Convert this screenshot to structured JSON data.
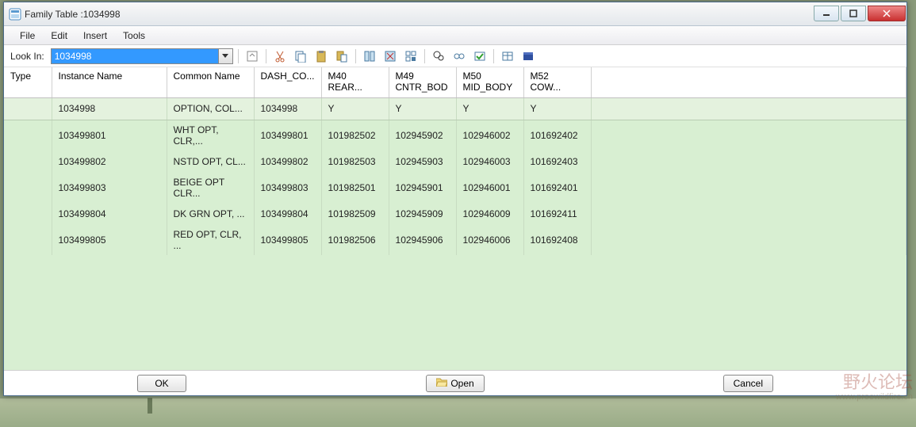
{
  "window": {
    "title": "Family Table :1034998"
  },
  "menu": [
    "File",
    "Edit",
    "Insert",
    "Tools"
  ],
  "lookin": {
    "label": "Look In:",
    "value": "1034998"
  },
  "toolbar_icons": [
    "open-instance-icon",
    "cut-icon",
    "copy-icon",
    "paste-icon",
    "paste-special-icon",
    "add-column-icon",
    "delete-column-icon",
    "find-icon",
    "preview-icon",
    "verify-icon",
    "table-icon",
    "lock-icon"
  ],
  "columns": [
    {
      "key": "type",
      "label": "Type",
      "cls": "col-type"
    },
    {
      "key": "instance",
      "label": "Instance Name",
      "cls": "col-inst"
    },
    {
      "key": "common",
      "label": "Common Name",
      "cls": "col-common"
    },
    {
      "key": "dash",
      "label": "DASH_CO...",
      "cls": "col-dash"
    },
    {
      "key": "m40",
      "label": "M40\nREAR...",
      "cls": "col-m"
    },
    {
      "key": "m49",
      "label": "M49\nCNTR_BOD",
      "cls": "col-m"
    },
    {
      "key": "m50",
      "label": "M50\nMID_BODY",
      "cls": "col-m"
    },
    {
      "key": "m52",
      "label": "M52\nCOW...",
      "cls": "col-m"
    }
  ],
  "rows": [
    {
      "type": "",
      "instance": "1034998",
      "common": "OPTION, COL...",
      "dash": "1034998",
      "m40": "Y",
      "m49": "Y",
      "m50": "Y",
      "m52": "Y"
    },
    {
      "type": "",
      "instance": "103499801",
      "common": "WHT OPT, CLR,...",
      "dash": "103499801",
      "m40": "101982502",
      "m49": "102945902",
      "m50": "102946002",
      "m52": "101692402"
    },
    {
      "type": "",
      "instance": "103499802",
      "common": "NSTD OPT, CL...",
      "dash": "103499802",
      "m40": "101982503",
      "m49": "102945903",
      "m50": "102946003",
      "m52": "101692403"
    },
    {
      "type": "",
      "instance": "103499803",
      "common": "BEIGE OPT CLR...",
      "dash": "103499803",
      "m40": "101982501",
      "m49": "102945901",
      "m50": "102946001",
      "m52": "101692401"
    },
    {
      "type": "",
      "instance": "103499804",
      "common": "DK GRN OPT, ...",
      "dash": "103499804",
      "m40": "101982509",
      "m49": "102945909",
      "m50": "102946009",
      "m52": "101692411"
    },
    {
      "type": "",
      "instance": "103499805",
      "common": "RED OPT, CLR, ...",
      "dash": "103499805",
      "m40": "101982506",
      "m49": "102945906",
      "m50": "102946006",
      "m52": "101692408"
    }
  ],
  "footer": {
    "ok": "OK",
    "open": "Open",
    "cancel": "Cancel"
  },
  "watermark": {
    "text": "野火论坛",
    "url": "www.proewildfire.cn"
  }
}
